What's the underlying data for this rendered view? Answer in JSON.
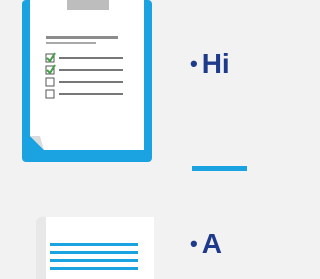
{
  "bullets": [
    {
      "text": "Hi"
    },
    {
      "text": "A"
    }
  ],
  "icons": {
    "clipboard": "clipboard-checklist-icon",
    "document": "document-lines-icon"
  },
  "colors": {
    "background": "#f2f2f2",
    "frame": "#1aa3e0",
    "text": "#1e3a8a",
    "accent_line": "#1aa3e0",
    "check_green": "#43a047"
  }
}
